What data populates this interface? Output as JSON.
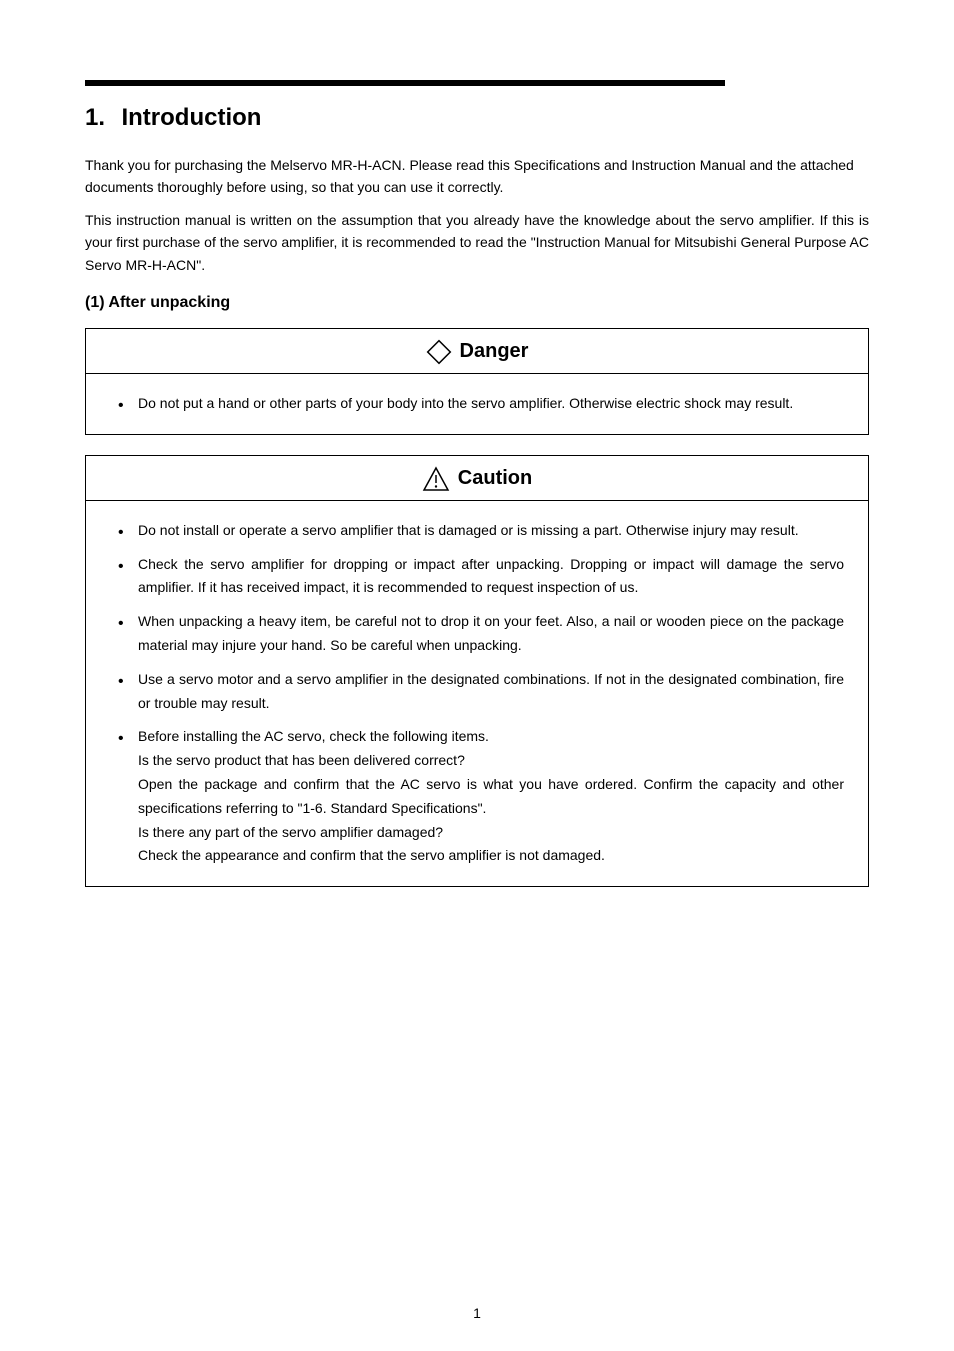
{
  "section": {
    "number": "1.",
    "title": "Introduction"
  },
  "paragraphs": {
    "intro1": "Thank you for purchasing the Melservo MR-H-ACN. Please read this Specifications and Instruction Manual and the attached documents thoroughly before using, so that you can use it correctly.",
    "intro2": "This instruction manual is written on the assumption that you already have the knowledge about the servo amplifier. If this is your first purchase of the servo amplifier, it is recommended to read the \"Instruction Manual for Mitsubishi General Purpose AC Servo MR-H-ACN\"."
  },
  "subsection": {
    "title": "(1) After unpacking"
  },
  "danger": {
    "header": "Danger",
    "items": [
      "Do not put a hand or other parts of your body into the servo amplifier. Otherwise electric shock may result."
    ]
  },
  "caution": {
    "header": "Caution",
    "items": [
      "Do not install or operate a servo amplifier that is damaged or is missing a part. Otherwise injury may result.",
      "Check the servo amplifier for dropping or impact after unpacking. Dropping or impact will damage the servo amplifier. If it has received impact, it is recommended to request inspection of us.",
      "When unpacking a heavy item, be careful not to drop it on your feet. Also, a nail or wooden piece on the package material may injure your hand. So be careful when unpacking.",
      "Use a servo motor and a servo amplifier in the designated combinations. If not in the designated combination, fire or trouble may result.",
      "Before installing the AC servo, check the following items.\n  Is the servo product that has been delivered correct?\n  Open the package and confirm that the AC servo is what you have ordered. Confirm the capacity and other specifications referring to \"1-6. Standard Specifications\".\n  Is there any part of the servo amplifier damaged?\n  Check the appearance and confirm that the servo amplifier is not damaged."
    ]
  },
  "pageNumber": "1"
}
